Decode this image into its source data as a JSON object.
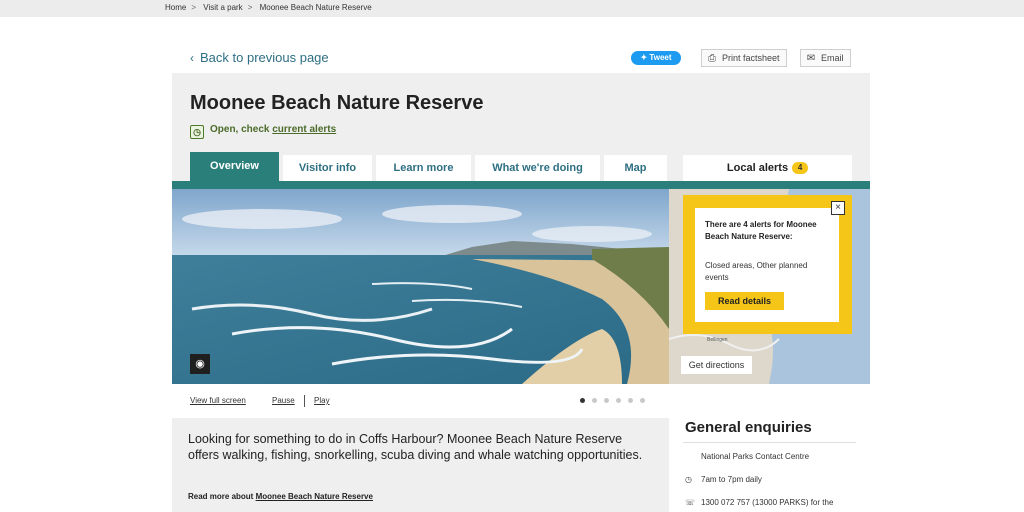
{
  "breadcrumb": [
    "Home",
    "Visit a park",
    "Moonee Beach Nature Reserve"
  ],
  "breadcrumb_sep": ">",
  "back_link": "Back to previous page",
  "share": {
    "tweet": "Tweet",
    "print": "Print factsheet",
    "email": "Email"
  },
  "park": {
    "title": "Moonee Beach Nature Reserve",
    "status_prefix": "Open, check",
    "status_link": "current alerts"
  },
  "tabs": [
    {
      "label": "Overview",
      "active": true
    },
    {
      "label": "Visitor info"
    },
    {
      "label": "Learn more"
    },
    {
      "label": "What we're doing"
    },
    {
      "label": "Map"
    }
  ],
  "alerts_tab": {
    "label": "Local alerts",
    "count": "4"
  },
  "alerts_popup": {
    "title": "There are 4 alerts for Moonee Beach Nature Reserve:",
    "body": "Closed areas, Other planned events",
    "button": "Read details",
    "close": "×"
  },
  "map": {
    "place_label": "Bellingen",
    "directions": "Get directions"
  },
  "gallery": {
    "full_screen": "View full screen",
    "pause": "Pause",
    "play": "Play",
    "slides": 6,
    "active_slide": 1
  },
  "intro": {
    "text": "Looking for something to do in Coffs Harbour? Moonee Beach Nature Reserve offers walking, fishing, snorkelling, scuba diving and whale watching opportunities.",
    "readmore_prefix": "Read more about",
    "readmore_link": "Moonee Beach Nature Reserve"
  },
  "enquiries": {
    "title": "General enquiries",
    "centre": "National Parks Contact Centre",
    "hours": "7am to 7pm daily",
    "phone": "1300 072 757 (13000 PARKS) for the"
  },
  "colors": {
    "teal": "#2b7f7b",
    "link": "#2e6f83",
    "alert_yellow": "#f5c518",
    "tweet_blue": "#1d9bf0"
  },
  "icons": {
    "clock": "clock-icon",
    "camera": "camera-icon",
    "print": "printer-icon",
    "email": "envelope-icon"
  }
}
